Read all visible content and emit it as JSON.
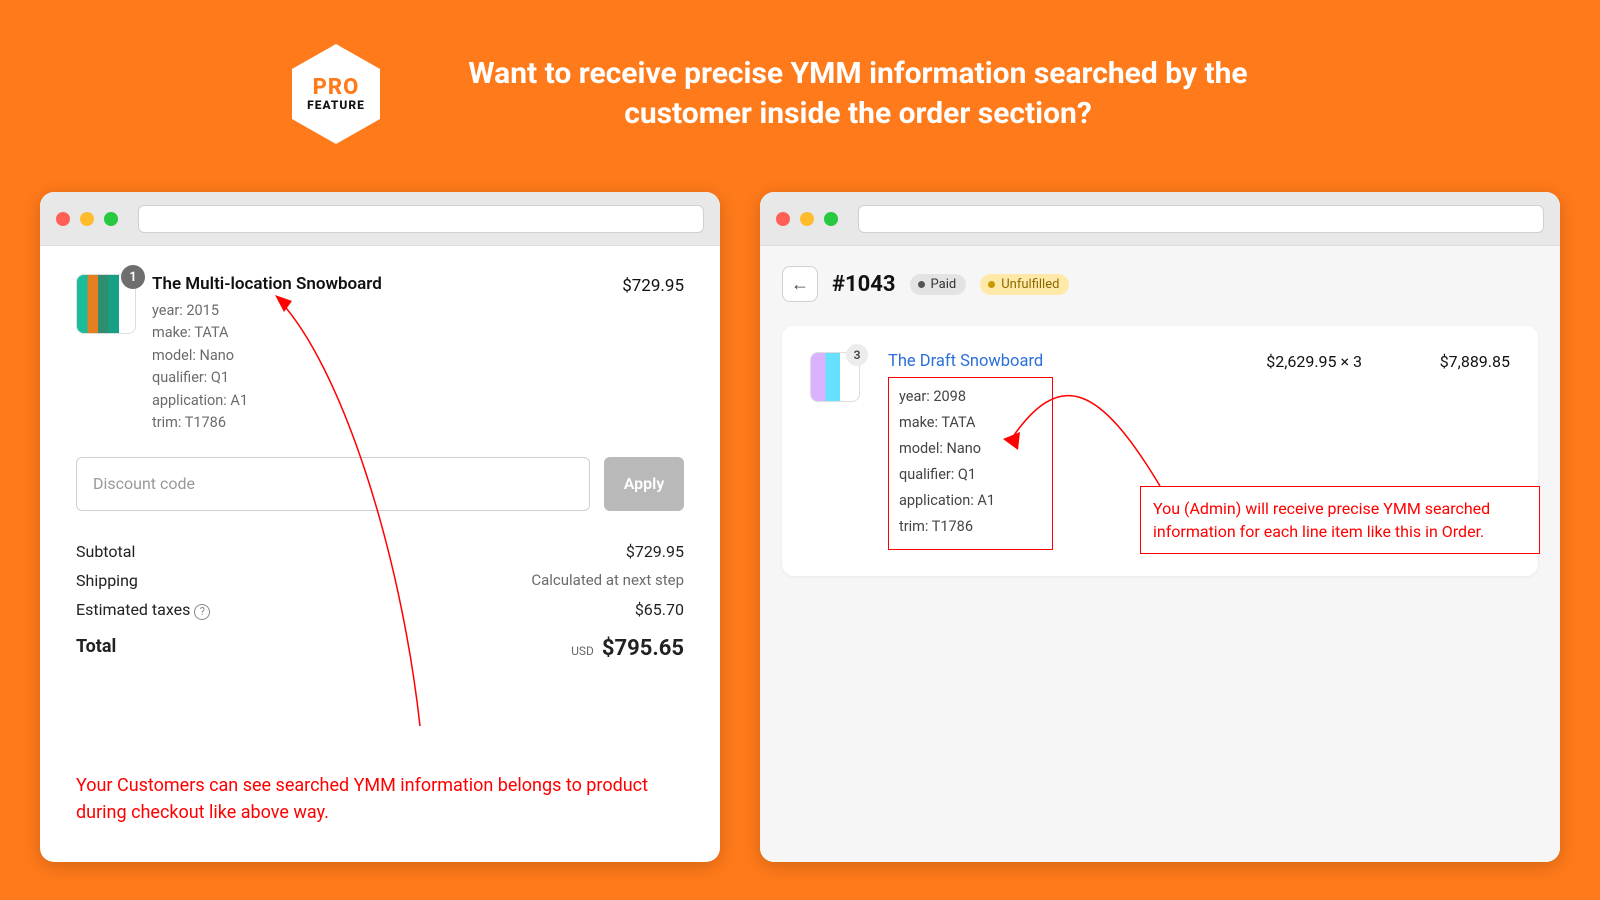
{
  "header": {
    "badge_top": "PRO",
    "badge_bottom": "FEATURE",
    "headline": "Want to receive precise YMM information searched by the customer inside the order section?"
  },
  "checkout": {
    "qty_badge": "1",
    "product_title": "The Multi-location Snowboard",
    "meta": {
      "year": "year: 2015",
      "make": "make: TATA",
      "model": "model: Nano",
      "qualifier": "qualifier: Q1",
      "application": "application: A1",
      "trim": "trim: T1786"
    },
    "line_price": "$729.95",
    "discount_placeholder": "Discount code",
    "apply_label": "Apply",
    "totals": {
      "subtotal_label": "Subtotal",
      "subtotal_value": "$729.95",
      "shipping_label": "Shipping",
      "shipping_value": "Calculated at next step",
      "taxes_label": "Estimated taxes",
      "taxes_value": "$65.70",
      "total_label": "Total",
      "currency": "USD",
      "total_value": "$795.65"
    },
    "annotation": "Your Customers can see searched YMM information belongs to product during checkout like above way."
  },
  "order": {
    "back_glyph": "←",
    "order_id": "#1043",
    "paid_label": "Paid",
    "unfulfilled_label": "Unfulfilled",
    "qty_badge": "3",
    "product_link": "The Draft Snowboard",
    "meta": {
      "year": "year: 2098",
      "make": "make: TATA",
      "model": "model: Nano",
      "qualifier": "qualifier: Q1",
      "application": "application: A1",
      "trim": "trim: T1786"
    },
    "unit_price_qty": "$2,629.95 × 3",
    "line_total": "$7,889.85",
    "annotation": "You (Admin) will receive precise YMM searched information for each line item like this in Order."
  }
}
